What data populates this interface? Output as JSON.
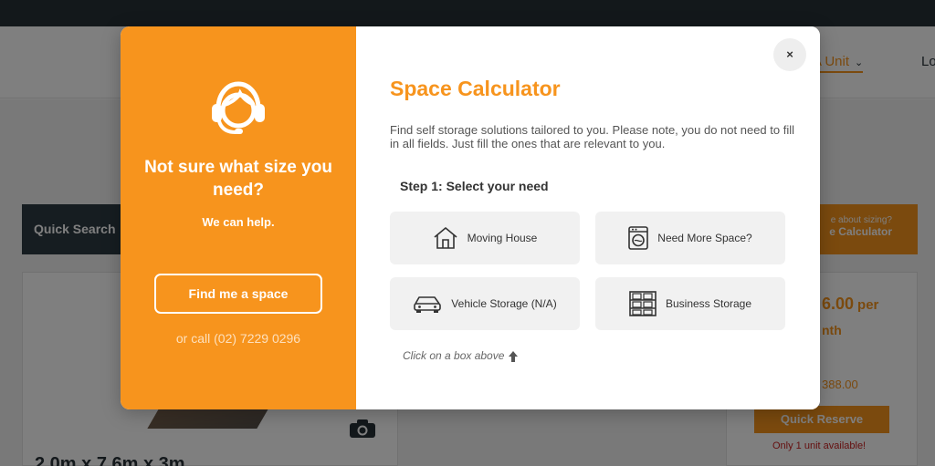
{
  "background": {
    "nav": {
      "find_unit": "A Unit",
      "login": "Lo"
    },
    "quick_search": "Quick Search",
    "sizing": {
      "question": "e about sizing?",
      "calculator": "e Calculator"
    },
    "price": {
      "amount": "6.00",
      "per": "per",
      "month": "nth",
      "total": "388.00"
    },
    "quick_reserve": "Quick Reserve",
    "availability": "Only 1 unit available!",
    "unit_dims": "2.0m x 7.6m x 3m"
  },
  "modal": {
    "left": {
      "heading": "Not sure what size you need?",
      "subheading": "We can help.",
      "find_button": "Find me a space",
      "call_text": "or call (02) 7229 0296"
    },
    "close_label": "×",
    "title": "Space Calculator",
    "description": "Find self storage solutions tailored to you. Please note, you do not need to fill in all fields. Just fill the ones that are relevant to you.",
    "step_label": "Step 1: Select your need",
    "options": [
      {
        "label": "Moving House",
        "icon": "house-icon"
      },
      {
        "label": "Need More Space?",
        "icon": "washing-machine-icon"
      },
      {
        "label": "Vehicle Storage (N/A)",
        "icon": "car-icon"
      },
      {
        "label": "Business Storage",
        "icon": "shelves-icon"
      }
    ],
    "hint": "Click on a box above"
  },
  "colors": {
    "accent": "#f7941d",
    "topbar": "#263037",
    "option_bg": "#f1f1f1",
    "alert": "#c81e1e"
  }
}
